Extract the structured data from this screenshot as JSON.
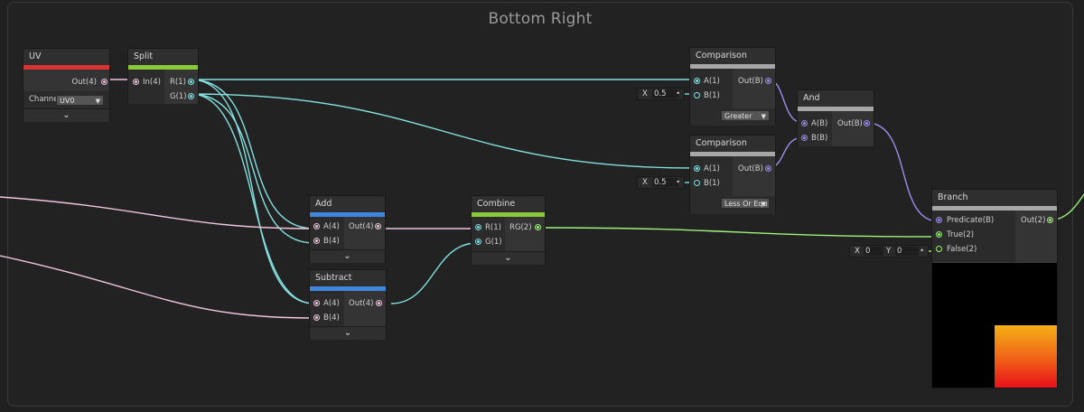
{
  "group": {
    "title": "Bottom Right"
  },
  "colors": {
    "uv_accent": "#d93333",
    "split_accent": "#89c93a",
    "add_accent": "#3f86e0",
    "combine_accent": "#89c93a",
    "comparison_accent": "#a7a7a7",
    "wire_float": "#84e0e0",
    "wire_vec4": "#f0c5de",
    "wire_vec2": "#9ef27a",
    "wire_bool": "#9a8ef0"
  },
  "nodes": {
    "uv": {
      "title": "UV",
      "out": "Out(4)",
      "channel_label": "Channe",
      "channel_value": "UV0"
    },
    "split": {
      "title": "Split",
      "in": "In(4)",
      "r": "R(1)",
      "g": "G(1)"
    },
    "add": {
      "title": "Add",
      "a": "A(4)",
      "b": "B(4)",
      "out": "Out(4)"
    },
    "subtract": {
      "title": "Subtract",
      "a": "A(4)",
      "b": "B(4)",
      "out": "Out(4)"
    },
    "combine": {
      "title": "Combine",
      "r": "R(1)",
      "g": "G(1)",
      "out": "RG(2)"
    },
    "comparison1": {
      "title": "Comparison",
      "a": "A(1)",
      "b": "B(1)",
      "out": "Out(B)",
      "mode": "Greater",
      "x_label": "X",
      "x_value": "0.5"
    },
    "comparison2": {
      "title": "Comparison",
      "a": "A(1)",
      "b": "B(1)",
      "out": "Out(B)",
      "mode": "Less Or Equ",
      "x_label": "X",
      "x_value": "0.5"
    },
    "and": {
      "title": "And",
      "a": "A(B)",
      "b": "B(B)",
      "out": "Out(B)"
    },
    "branch": {
      "title": "Branch",
      "predicate": "Predicate(B)",
      "true": "True(2)",
      "false": "False(2)",
      "out": "Out(2)",
      "false_x_label": "X",
      "false_x_value": "0",
      "false_y_label": "Y",
      "false_y_value": "0"
    }
  }
}
